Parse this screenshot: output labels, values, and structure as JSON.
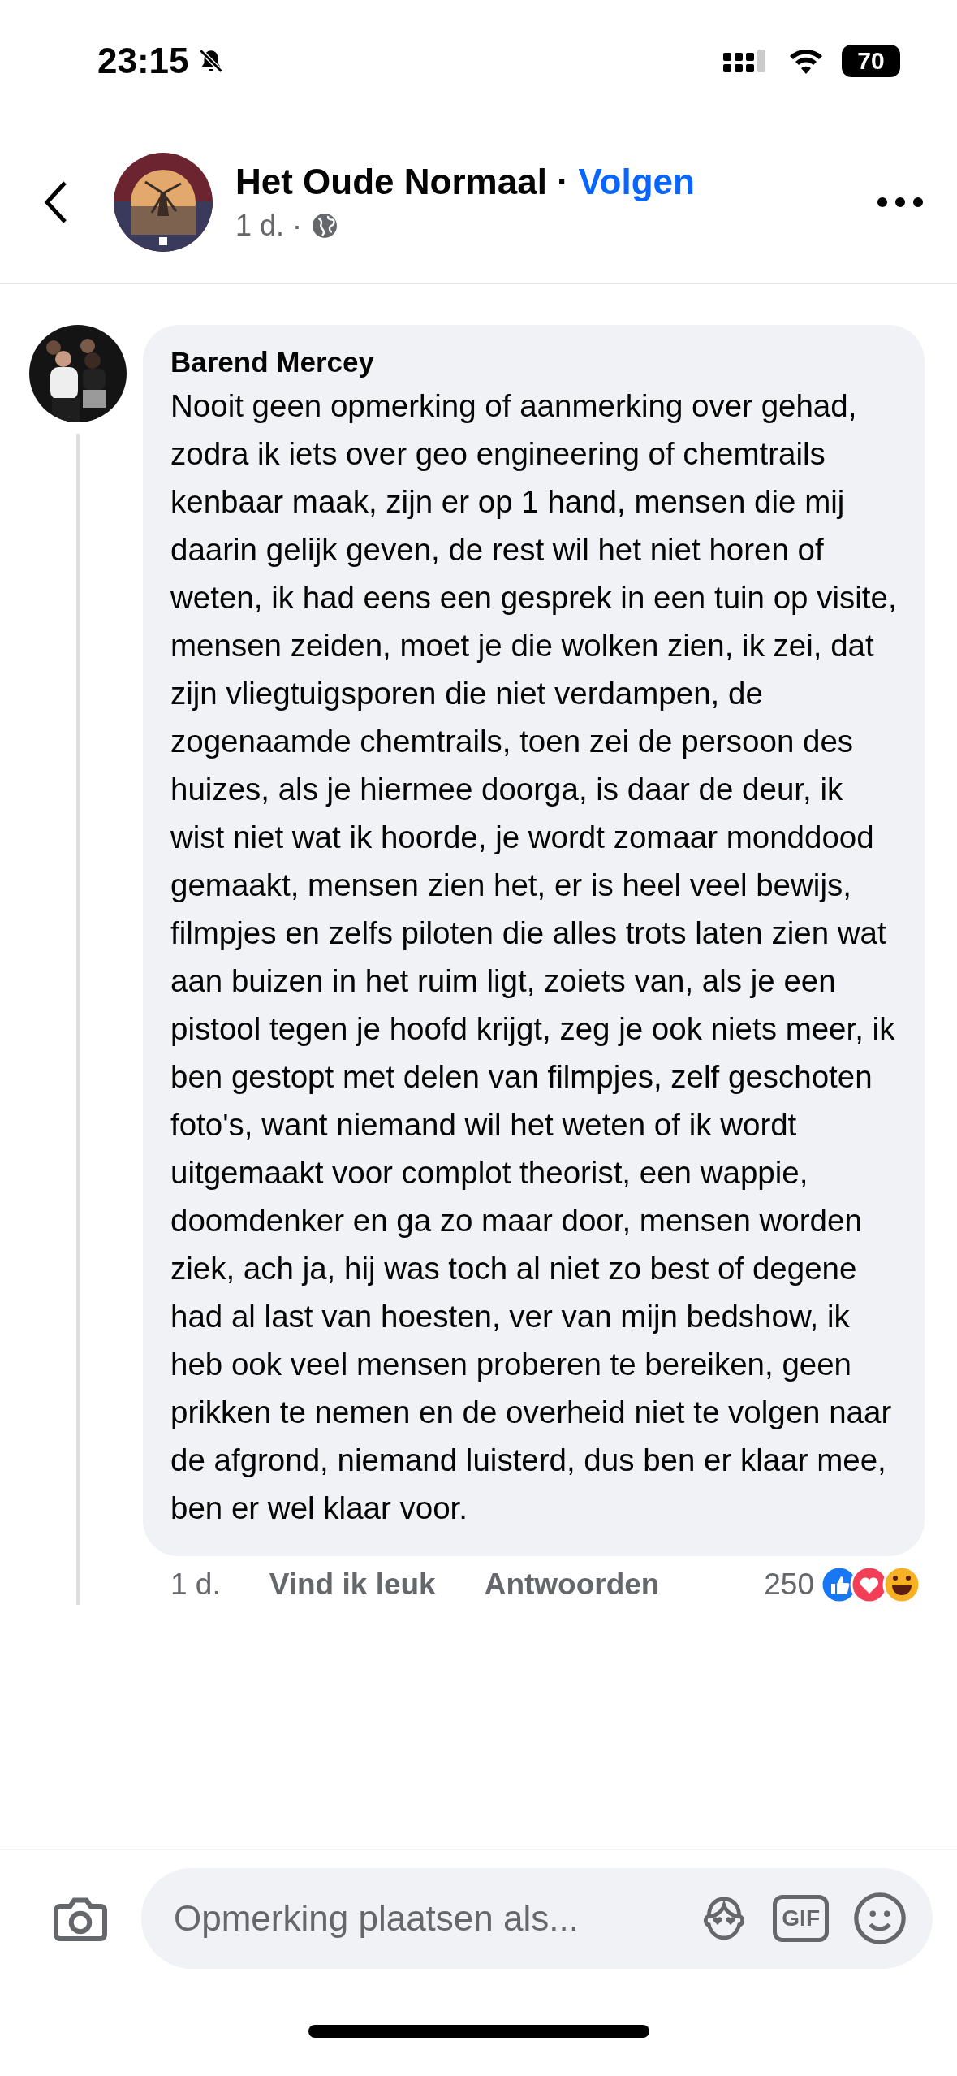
{
  "status_bar": {
    "time": "23:15",
    "muted": true,
    "battery": "70"
  },
  "header": {
    "page_name": "Het Oude Normaal",
    "separator": "·",
    "follow": "Volgen",
    "time": "1 d.",
    "dot": "·"
  },
  "comment": {
    "author": "Barend Mercey",
    "text": "Nooit geen opmerking of aanmerking over gehad, zodra ik iets over geo engineering of chemtrails kenbaar maak, zijn er op 1 hand, mensen die mij daarin gelijk geven, de rest wil het niet horen of weten, ik had eens een gesprek in een tuin op visite, mensen zeiden, moet je die wolken zien, ik zei, dat zijn vliegtuigsporen die niet verdampen, de zogenaamde chemtrails, toen zei de persoon des huizes, als je hiermee doorga, is daar de deur, ik wist niet wat ik hoorde, je wordt zomaar monddood gemaakt, mensen zien het, er is heel veel bewijs, filmpjes en zelfs piloten die alles trots laten zien wat aan buizen in het ruim ligt, zoiets van, als je een pistool tegen je hoofd krijgt, zeg je ook niets meer, ik ben gestopt met delen van filmpjes, zelf geschoten foto's, want niemand wil het weten of ik wordt uitgemaakt voor complot theorist, een wappie, doomdenker en ga zo maar door, mensen worden ziek, ach ja, hij was toch al niet zo best of degene had al last van hoesten, ver van mijn bedshow, ik heb ook veel mensen proberen te bereiken, geen prikken te nemen en de overheid niet te volgen naar de afgrond, niemand luisterd, dus ben er klaar mee, ben er wel klaar voor.",
    "time": "1 d.",
    "like": "Vind ik leuk",
    "reply": "Antwoorden",
    "reaction_count": "250"
  },
  "composer": {
    "placeholder": "Opmerking plaatsen als...",
    "gif_label": "GIF"
  }
}
